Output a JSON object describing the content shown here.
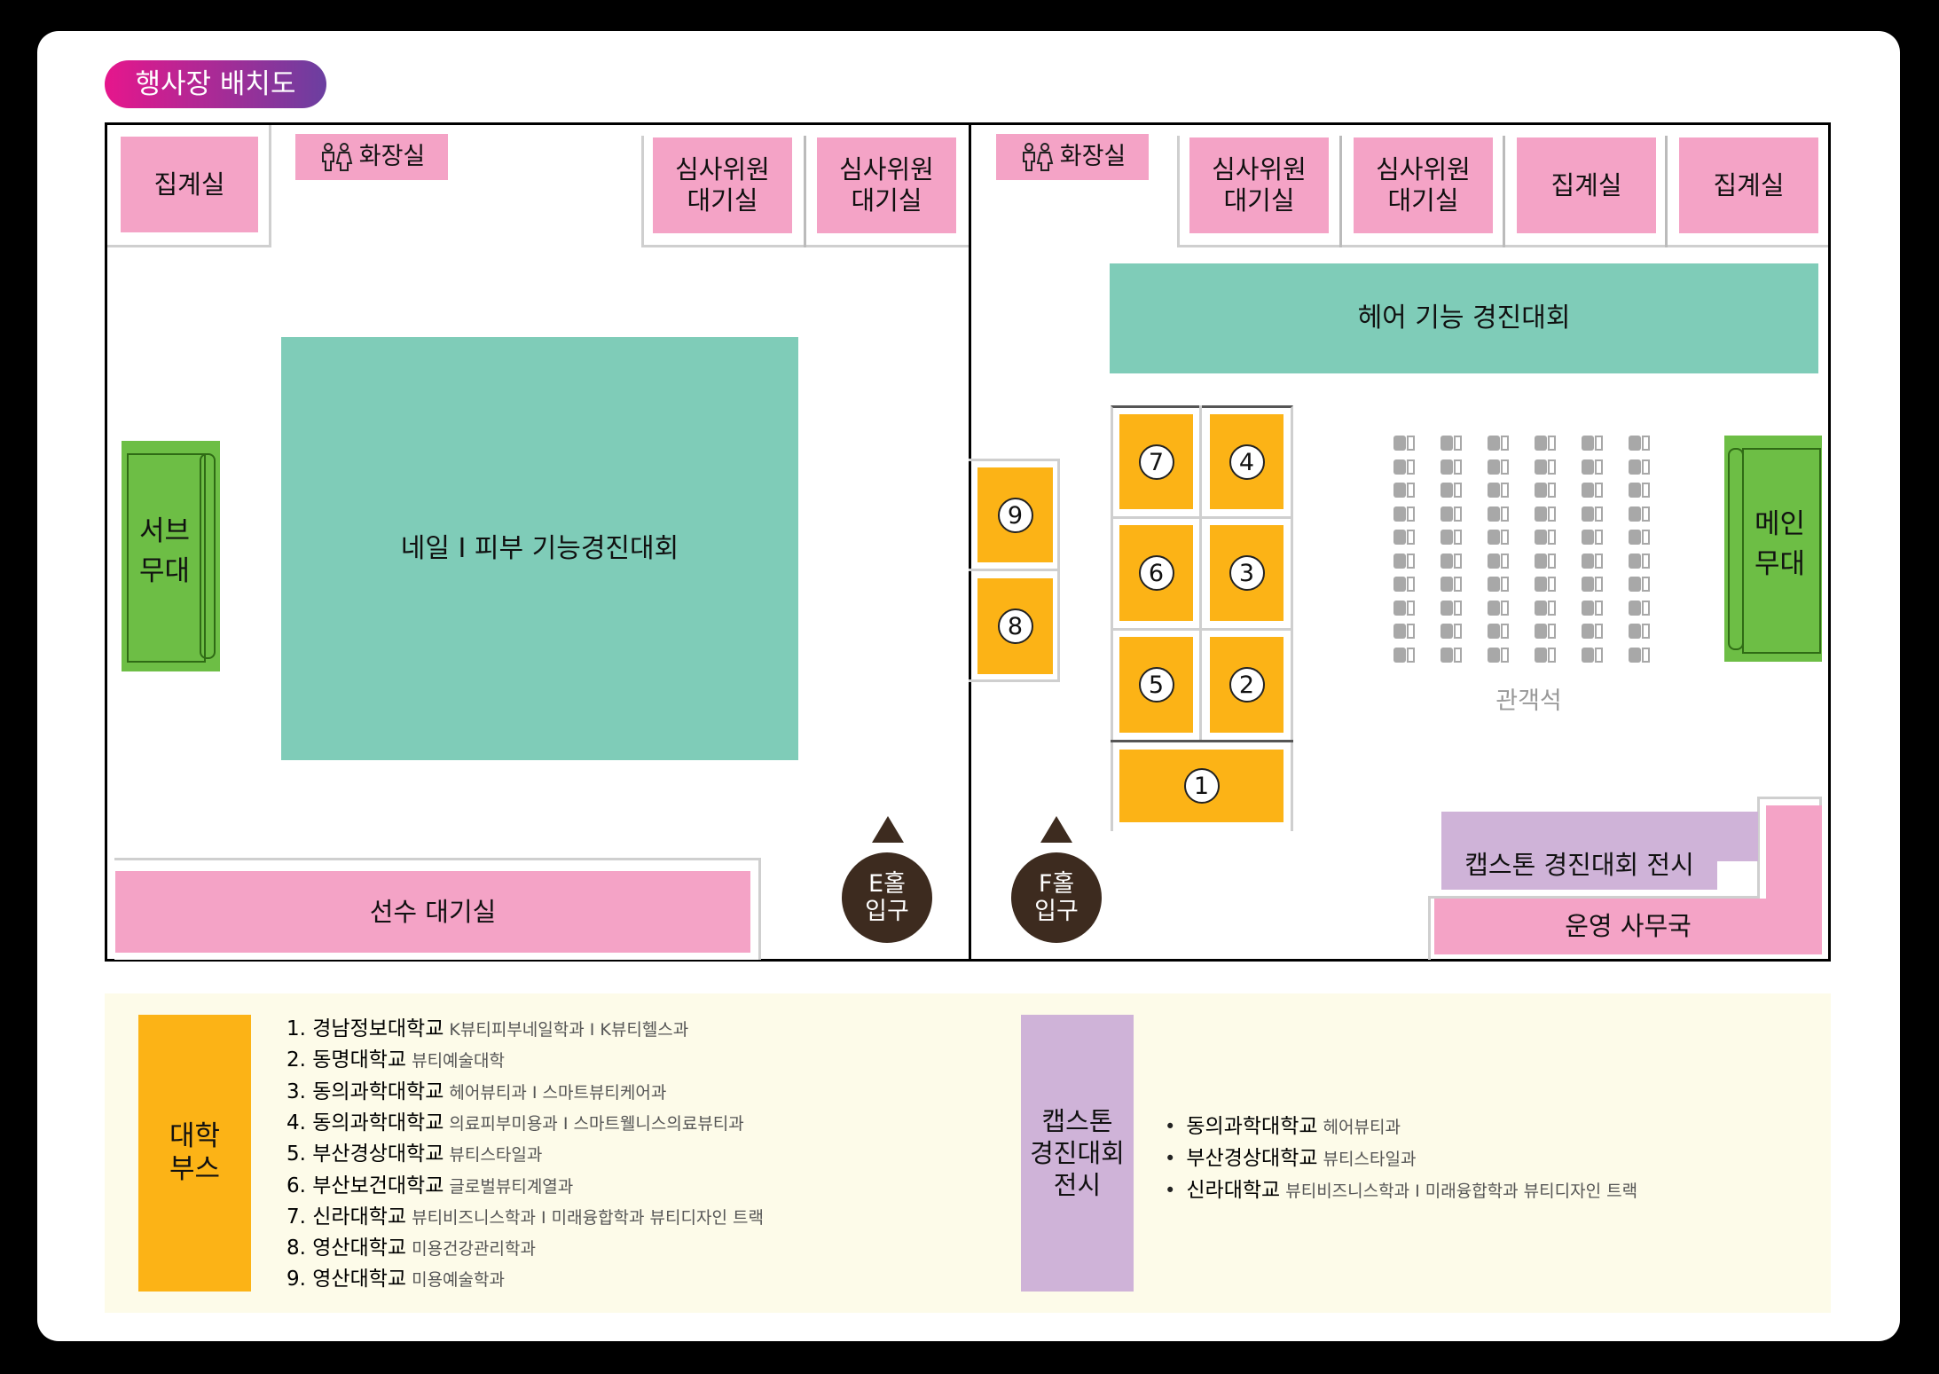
{
  "title": "행사장 배치도",
  "hall_e": {
    "rooms": {
      "tally": "집계실",
      "restroom": "화장실",
      "judges1": "심사위원\n대기실",
      "judges2": "심사위원\n대기실",
      "main_area": "네일 I 피부 기능경진대회",
      "sub_stage": "서브\n무대",
      "waiting": "선수 대기실"
    },
    "entrance": "E홀\n입구"
  },
  "hall_f": {
    "rooms": {
      "restroom": "화장실",
      "judges1": "심사위원\n대기실",
      "judges2": "심사위원\n대기실",
      "tally1": "집계실",
      "tally2": "집계실",
      "hair": "헤어 기능 경진대회",
      "main_stage": "메인\n무대",
      "audience": "관객석",
      "capstone": "캡스톤 경진대회 전시",
      "office": "운영 사무국"
    },
    "entrance": "F홀\n입구",
    "booths": [
      "1",
      "2",
      "3",
      "4",
      "5",
      "6",
      "7",
      "8",
      "9"
    ]
  },
  "legend": {
    "univ_label": "대학\n부스",
    "univ_items": [
      {
        "name": "1. 경남정보대학교",
        "dept": "K뷰티피부네일학과 I K뷰티헬스과"
      },
      {
        "name": "2. 동명대학교",
        "dept": "뷰티예술대학"
      },
      {
        "name": "3. 동의과학대학교",
        "dept": "헤어뷰티과 I 스마트뷰티케어과"
      },
      {
        "name": "4. 동의과학대학교",
        "dept": "의료피부미용과 I 스마트웰니스의료뷰티과"
      },
      {
        "name": "5. 부산경상대학교",
        "dept": "뷰티스타일과"
      },
      {
        "name": "6. 부산보건대학교",
        "dept": "글로벌뷰티계열과"
      },
      {
        "name": "7. 신라대학교",
        "dept": "뷰티비즈니스학과 I 미래융합학과 뷰티디자인 트랙"
      },
      {
        "name": "8. 영산대학교",
        "dept": "미용건강관리학과"
      },
      {
        "name": "9. 영산대학교",
        "dept": "미용예술학과"
      }
    ],
    "capstone_label": "캡스톤\n경진대회\n전시",
    "capstone_items": [
      {
        "name": "동의과학대학교",
        "dept": "헤어뷰티과"
      },
      {
        "name": "부산경상대학교",
        "dept": "뷰티스타일과"
      },
      {
        "name": "신라대학교",
        "dept": "뷰티비즈니스학과 I 미래융합학과 뷰티디자인 트랙"
      }
    ]
  },
  "colors": {
    "pink": "#f4a3c6",
    "mint": "#7fccb8",
    "orange": "#fcb316",
    "purple": "#cfb3d8",
    "green": "#6dbe45",
    "entrance": "#3d2b1f"
  }
}
